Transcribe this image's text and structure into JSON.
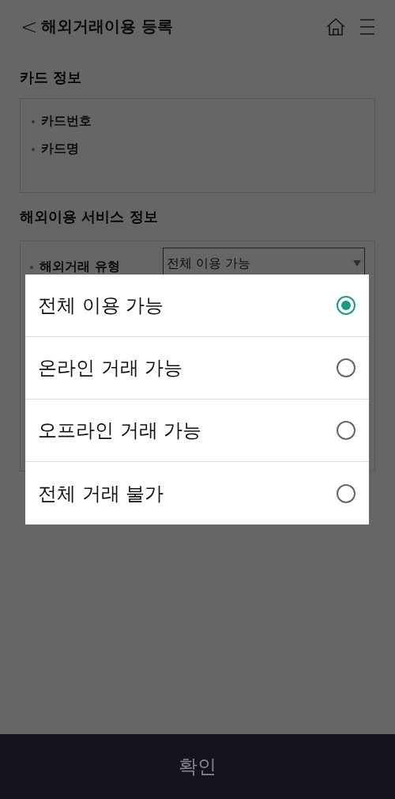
{
  "header": {
    "back": "<",
    "title": "해외거래이용 등록"
  },
  "card_info": {
    "title": "카드 정보",
    "items": [
      "카드번호",
      "카드명"
    ]
  },
  "service_info": {
    "title": "해외이용 서비스 정보",
    "field_label": "해외거래 유형",
    "field_value": "전체 이용 가능"
  },
  "options": [
    {
      "label": "전체 이용 가능",
      "selected": true
    },
    {
      "label": "온라인 거래 가능",
      "selected": false
    },
    {
      "label": "오프라인 거래 가능",
      "selected": false
    },
    {
      "label": "전체 거래 불가",
      "selected": false
    }
  ],
  "confirm_button": "확인"
}
